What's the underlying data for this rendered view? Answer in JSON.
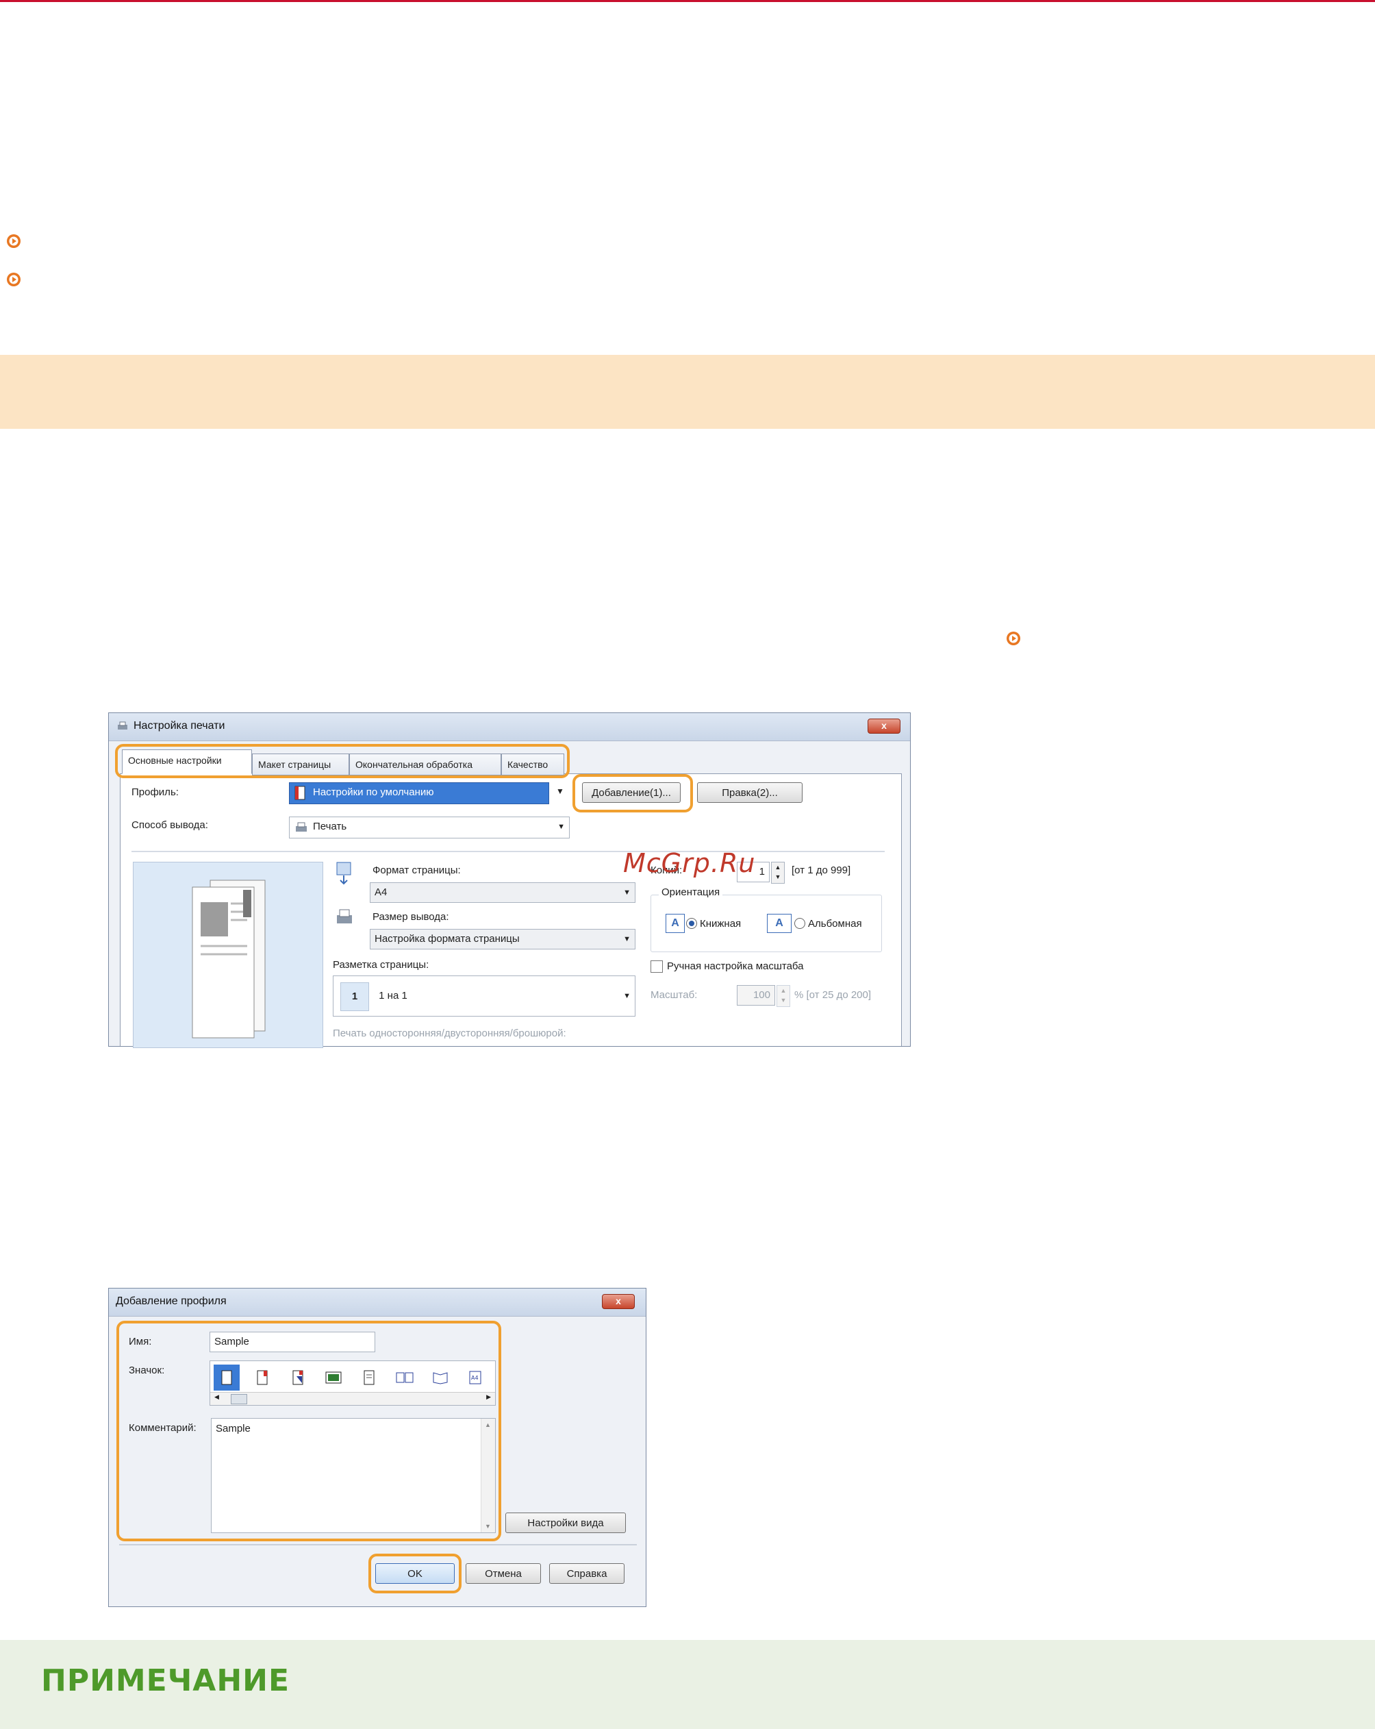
{
  "watermark": "McGrp.Ru",
  "note": {
    "title": "ПРИМЕЧАНИЕ"
  },
  "print_dialog": {
    "title": "Настройка печати",
    "close": "x",
    "tabs": [
      "Основные настройки",
      "Макет страницы",
      "Окончательная обработка",
      "Качество"
    ],
    "profile_label": "Профиль:",
    "profile_value": "Настройки по умолчанию",
    "add_button": "Добавление(1)...",
    "edit_button": "Правка(2)...",
    "output_method_label": "Способ вывода:",
    "output_method_value": "Печать",
    "page_size_label": "Формат страницы:",
    "page_size_value": "A4",
    "output_size_label": "Размер вывода:",
    "output_size_value": "Настройка формата страницы",
    "copies_label": "Копий:",
    "copies_value": "1",
    "copies_range": "[от 1 до 999]",
    "orientation_label": "Ориентация",
    "portrait_label": "Книжная",
    "landscape_label": "Альбомная",
    "layout_label": "Разметка страницы:",
    "layout_number": "1",
    "layout_value": "1 на 1",
    "manual_scaling_label": "Ручная настройка масштаба",
    "scaling_label": "Масштаб:",
    "scaling_value": "100",
    "scaling_range": "% [от 25 до 200]",
    "duplex_label": "Печать односторонняя/двусторонняя/брошюрой:"
  },
  "add_profile_dialog": {
    "title": "Добавление профиля",
    "close": "x",
    "name_label": "Имя:",
    "name_value": "Sample",
    "icon_label": "Значок:",
    "comment_label": "Комментарий:",
    "comment_value": "Sample",
    "view_settings_button": "Настройки вида",
    "ok_button": "OK",
    "cancel_button": "Отмена",
    "help_button": "Справка"
  }
}
